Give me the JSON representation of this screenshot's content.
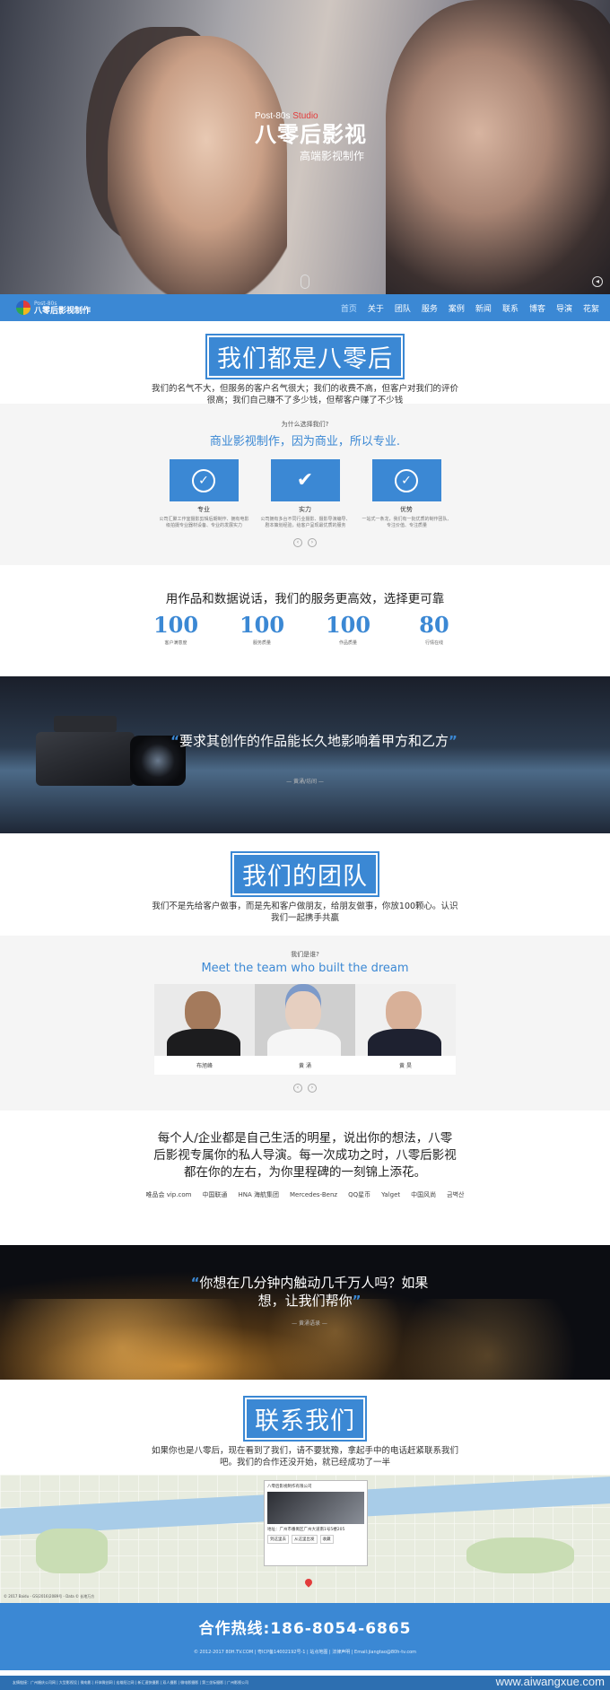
{
  "hero": {
    "brand_en": "Post-80s ",
    "brand_en_accent": "Studio",
    "brand_cn": "八零后影视",
    "brand_sub": "高端影视制作"
  },
  "nav": {
    "logo_small": "Post-80s",
    "logo_name": "八零后影视制作",
    "items": [
      "首页",
      "关于",
      "团队",
      "服务",
      "案例",
      "新闻",
      "联系",
      "博客",
      "导演",
      "花絮"
    ]
  },
  "about": {
    "title": "我们都是八零后",
    "desc": "我们的名气不大，但服务的客户名气很大；我们的收费不高，但客户对我们的评价很高；我们自己赚不了多少钱，但帮客户赚了不少钱"
  },
  "why": {
    "small": "为什么选择我们?",
    "heading": "商业影视制作，因为商业，所以专业.",
    "cards": [
      {
        "name": "专业",
        "text": "公司汇聚工作室摄影剪辑后期制作、拥有电影级拍摄专业器材设备、专业的发展实力"
      },
      {
        "name": "实力",
        "text": "公司拥有多台不同行业摄影、摄影导演编导、剧本策划经验，给客户呈现最优质的服务"
      },
      {
        "name": "优势",
        "text": "一站式一条龙，我们有一批优质的制作团队、专注价值、专注质量"
      }
    ]
  },
  "stats": {
    "heading": "用作品和数据说话，我们的服务更高效，选择更可靠",
    "items": [
      {
        "num": "100",
        "label": "客户满意度"
      },
      {
        "num": "100",
        "label": "服务质量"
      },
      {
        "num": "100",
        "label": "作品质量"
      },
      {
        "num": "80",
        "label": "行情在线"
      }
    ]
  },
  "quote1": {
    "open": "“",
    "text": "要求其创作的作品能长久地影响着甲方和乙方",
    "close": "”",
    "by": "— 黄涌/坊间 —"
  },
  "team_intro": {
    "title": "我们的团队",
    "desc": "我们不是先给客户做事，而是先和客户做朋友，给朋友做事，你放100颗心。认识我们一起携手共赢"
  },
  "team": {
    "small": "我们是谁?",
    "heading": "Meet the team who built the dream",
    "members": [
      {
        "name": "布旭峰"
      },
      {
        "name": "黄 涌"
      },
      {
        "name": "黄 昊"
      }
    ]
  },
  "slogan": {
    "text": "每个人/企业都是自己生活的明星，说出你的想法，八零后影视专属你的私人导演。每一次成功之时，八零后影视都在你的左右，为你里程碑的一刻锦上添花。",
    "logos": [
      "唯品会 vip.com",
      "中国联通",
      "HNA 海航集团",
      "Mercedes-Benz",
      "QQ星币",
      "Yalget",
      "中国风尚",
      "금벽산"
    ]
  },
  "quote2": {
    "open": "“",
    "text": "你想在几分钟内触动几千万人吗？如果想，让我们帮你",
    "close": "”",
    "by": "— 黄涌语录 —"
  },
  "contact": {
    "title": "联系我们",
    "desc": "如果你也是八零后，现在看到了我们，请不要犹豫，拿起手中的电话赶紧联系我们吧。我们的合作还没开始，就已经成功了一半",
    "map_popup_title": "八零后影视制作有限公司",
    "map_popup_text": "地址：广州市番禺区广州大道南1号5楼205",
    "map_popup_btns": [
      "到这里去",
      "从这里出发",
      "收藏"
    ],
    "map_copy": "© 2017 Baidu - GS(2016)2089号 - Data © 长地万方"
  },
  "footer": {
    "hotline": "合作热线:186-8054-6865",
    "copyright": "© 2012-2017 80H.TV.COM | 粤ICP备14002192号-1 | 站点地图 | 法律声明 | Email:jiangtao@80h-tv.com",
    "links": "友情链接：广州婚庆公司网 | 大型影视设 | 微电影 | 纤体微创网 | 宏雄阳江网 | 新汇速快摄影 | 双人摄影 | 微电影摄影 | 第三坐标摄影 | 广州影视公司"
  },
  "watermark": "www.aiwangxue.com"
}
